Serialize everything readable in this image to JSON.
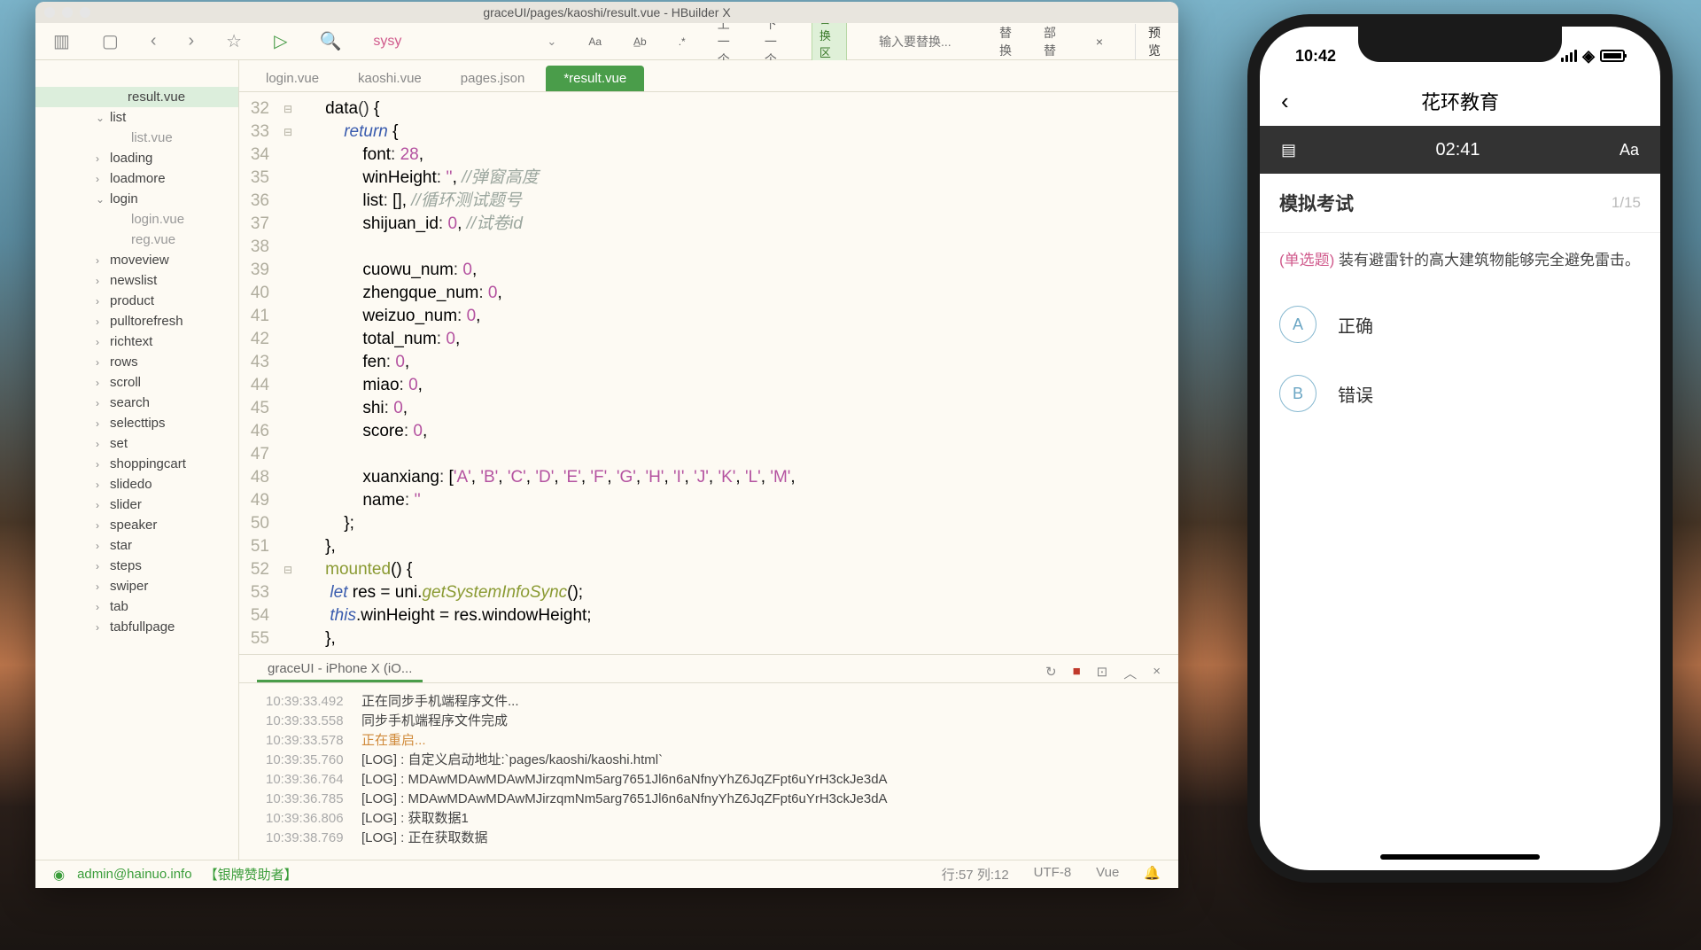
{
  "ide": {
    "title_path": "graceUI/pages/kaoshi/result.vue - HBuilder X",
    "find_text": "sysy",
    "prev_label": "上一个",
    "next_label": "下一个",
    "replace_zone_label": "替换区>>",
    "replace_placeholder": "输入要替换...",
    "replace_btn": "替换",
    "replace_all_btn": "全部替换",
    "preview_btn": "预览",
    "tree": [
      {
        "label": "result.vue",
        "indent": 88,
        "chev": "",
        "active": true
      },
      {
        "label": "list",
        "indent": 68,
        "chev": "v"
      },
      {
        "label": "list.vue",
        "indent": 92,
        "chev": "",
        "cls": "file"
      },
      {
        "label": "loading",
        "indent": 68,
        "chev": ">"
      },
      {
        "label": "loadmore",
        "indent": 68,
        "chev": ">"
      },
      {
        "label": "login",
        "indent": 68,
        "chev": "v"
      },
      {
        "label": "login.vue",
        "indent": 92,
        "chev": "",
        "cls": "file"
      },
      {
        "label": "reg.vue",
        "indent": 92,
        "chev": "",
        "cls": "file"
      },
      {
        "label": "moveview",
        "indent": 68,
        "chev": ">"
      },
      {
        "label": "newslist",
        "indent": 68,
        "chev": ">"
      },
      {
        "label": "product",
        "indent": 68,
        "chev": ">"
      },
      {
        "label": "pulltorefresh",
        "indent": 68,
        "chev": ">"
      },
      {
        "label": "richtext",
        "indent": 68,
        "chev": ">"
      },
      {
        "label": "rows",
        "indent": 68,
        "chev": ">"
      },
      {
        "label": "scroll",
        "indent": 68,
        "chev": ">"
      },
      {
        "label": "search",
        "indent": 68,
        "chev": ">"
      },
      {
        "label": "selecttips",
        "indent": 68,
        "chev": ">"
      },
      {
        "label": "set",
        "indent": 68,
        "chev": ">"
      },
      {
        "label": "shoppingcart",
        "indent": 68,
        "chev": ">"
      },
      {
        "label": "slidedo",
        "indent": 68,
        "chev": ">"
      },
      {
        "label": "slider",
        "indent": 68,
        "chev": ">"
      },
      {
        "label": "speaker",
        "indent": 68,
        "chev": ">"
      },
      {
        "label": "star",
        "indent": 68,
        "chev": ">"
      },
      {
        "label": "steps",
        "indent": 68,
        "chev": ">"
      },
      {
        "label": "swiper",
        "indent": 68,
        "chev": ">"
      },
      {
        "label": "tab",
        "indent": 68,
        "chev": ">"
      },
      {
        "label": "tabfullpage",
        "indent": 68,
        "chev": ">"
      }
    ],
    "tabs": [
      {
        "label": "login.vue",
        "active": false
      },
      {
        "label": "kaoshi.vue",
        "active": false
      },
      {
        "label": "pages.json",
        "active": false
      },
      {
        "label": "*result.vue",
        "active": true
      }
    ],
    "linestart": 32,
    "lines": 30,
    "console_tab": "graceUI - iPhone X (iO...",
    "console_rows": [
      {
        "ts": "10:39:33.492",
        "txt": "正在同步手机端程序文件..."
      },
      {
        "ts": "10:39:33.558",
        "txt": "同步手机端程序文件完成"
      },
      {
        "ts": "10:39:33.578",
        "txt": "正在重启...",
        "cls": "orange"
      },
      {
        "ts": "10:39:35.760",
        "txt": "[LOG] : 自定义启动地址:`pages/kaoshi/kaoshi.html`"
      },
      {
        "ts": "10:39:36.764",
        "txt": "[LOG] : MDAwMDAwMDAwMJirzqmNm5arg7651Jl6n6aNfnyYhZ6JqZFpt6uYrH3ckJe3dA"
      },
      {
        "ts": "10:39:36.785",
        "txt": "[LOG] : MDAwMDAwMDAwMJirzqmNm5arg7651Jl6n6aNfnyYhZ6JqZFpt6uYrH3ckJe3dA"
      },
      {
        "ts": "10:39:36.806",
        "txt": "[LOG] : 获取数据1"
      },
      {
        "ts": "10:39:38.769",
        "txt": "[LOG] : 正在获取数据"
      }
    ],
    "status": {
      "user": "admin@hainuo.info",
      "sponsor": "【银牌赞助者】",
      "pos": "行:57  列:12",
      "encoding": "UTF-8",
      "lang": "Vue"
    }
  },
  "phone": {
    "time": "10:42",
    "nav_title": "花环教育",
    "timer": "02:41",
    "exam_title": "模拟考试",
    "exam_count": "1/15",
    "q_type": "(单选题)",
    "q_text": " 装有避雷针的高大建筑物能够完全避免雷击。",
    "options": [
      {
        "badge": "A",
        "label": "正确"
      },
      {
        "badge": "B",
        "label": "错误"
      }
    ]
  }
}
